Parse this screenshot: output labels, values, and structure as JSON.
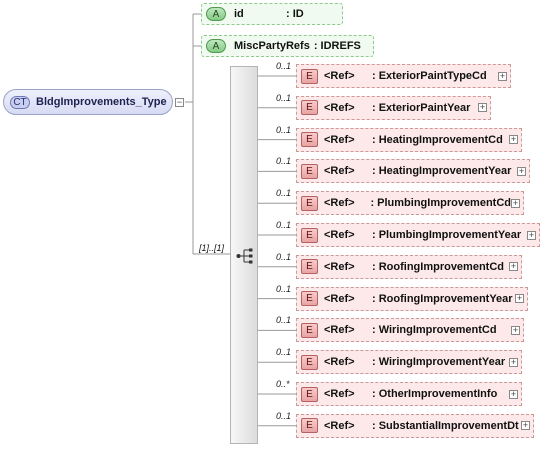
{
  "complex_type": {
    "badge": "CT",
    "name": "BldgImprovements_Type"
  },
  "attributes": [
    {
      "badge": "A",
      "name": "id",
      "type": ": ID"
    },
    {
      "badge": "A",
      "name": "MiscPartyRefs",
      "type": ": IDREFS"
    }
  ],
  "sequence": {
    "occurrence": "[1]..[1]"
  },
  "elements": [
    {
      "badge": "E",
      "occurrence": "0..1",
      "ref": "<Ref>",
      "name": ": ExteriorPaintTypeCd",
      "expand": "+"
    },
    {
      "badge": "E",
      "occurrence": "0..1",
      "ref": "<Ref>",
      "name": ": ExteriorPaintYear",
      "expand": "+"
    },
    {
      "badge": "E",
      "occurrence": "0..1",
      "ref": "<Ref>",
      "name": ": HeatingImprovementCd",
      "expand": "+"
    },
    {
      "badge": "E",
      "occurrence": "0..1",
      "ref": "<Ref>",
      "name": ": HeatingImprovementYear",
      "expand": "+"
    },
    {
      "badge": "E",
      "occurrence": "0..1",
      "ref": "<Ref>",
      "name": ": PlumbingImprovementCd",
      "expand": "+"
    },
    {
      "badge": "E",
      "occurrence": "0..1",
      "ref": "<Ref>",
      "name": ": PlumbingImprovementYear",
      "expand": "+"
    },
    {
      "badge": "E",
      "occurrence": "0..1",
      "ref": "<Ref>",
      "name": ": RoofingImprovementCd",
      "expand": "+"
    },
    {
      "badge": "E",
      "occurrence": "0..1",
      "ref": "<Ref>",
      "name": ": RoofingImprovementYear",
      "expand": "+"
    },
    {
      "badge": "E",
      "occurrence": "0..1",
      "ref": "<Ref>",
      "name": ": WiringImprovementCd",
      "expand": "+"
    },
    {
      "badge": "E",
      "occurrence": "0..1",
      "ref": "<Ref>",
      "name": ": WiringImprovementYear",
      "expand": "+"
    },
    {
      "badge": "E",
      "occurrence": "0..*",
      "ref": "<Ref>",
      "name": ": OtherImprovementInfo",
      "expand": "+"
    },
    {
      "badge": "E",
      "occurrence": "0..1",
      "ref": "<Ref>",
      "name": ": SubstantialImprovementDt",
      "expand": "+"
    }
  ]
}
